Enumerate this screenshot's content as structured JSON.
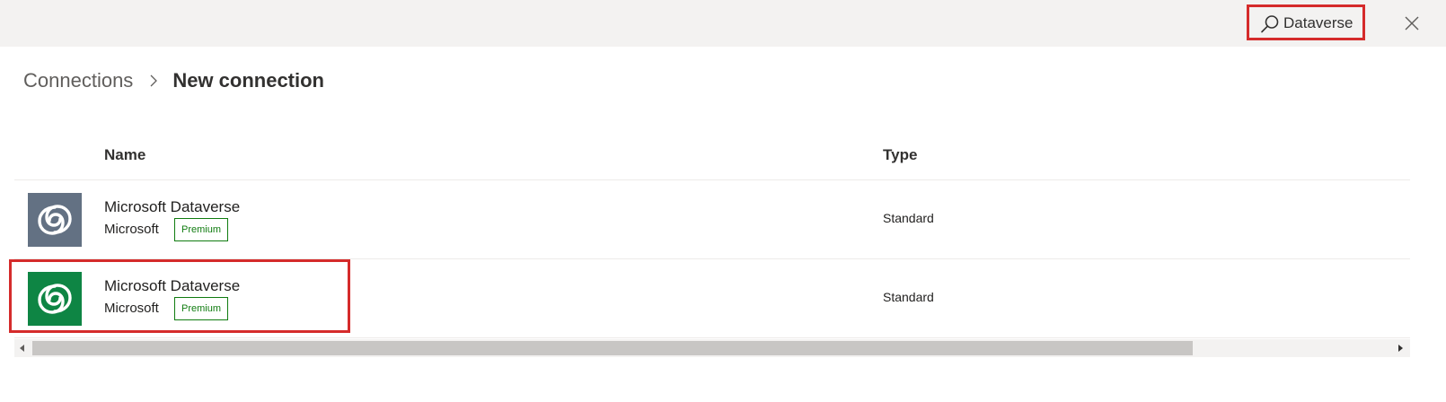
{
  "header": {
    "search": {
      "value": "Dataverse",
      "icon": "search-icon"
    },
    "close_icon": "close-icon"
  },
  "breadcrumb": {
    "parent": "Connections",
    "separator_icon": "chevron-right-icon",
    "current": "New connection"
  },
  "table": {
    "columns": [
      "Name",
      "Type"
    ],
    "rows": [
      {
        "name": "Microsoft Dataverse",
        "publisher": "Microsoft",
        "badge": "Premium",
        "type": "Standard",
        "icon": "dataverse-icon",
        "icon_color": "#637183"
      },
      {
        "name": "Microsoft Dataverse",
        "publisher": "Microsoft",
        "badge": "Premium",
        "type": "Standard",
        "icon": "dataverse-icon",
        "icon_color": "#0e8544"
      }
    ]
  },
  "colors": {
    "highlight": "#d52b2b",
    "premium": "#107c10",
    "topbar": "#f3f2f1"
  }
}
